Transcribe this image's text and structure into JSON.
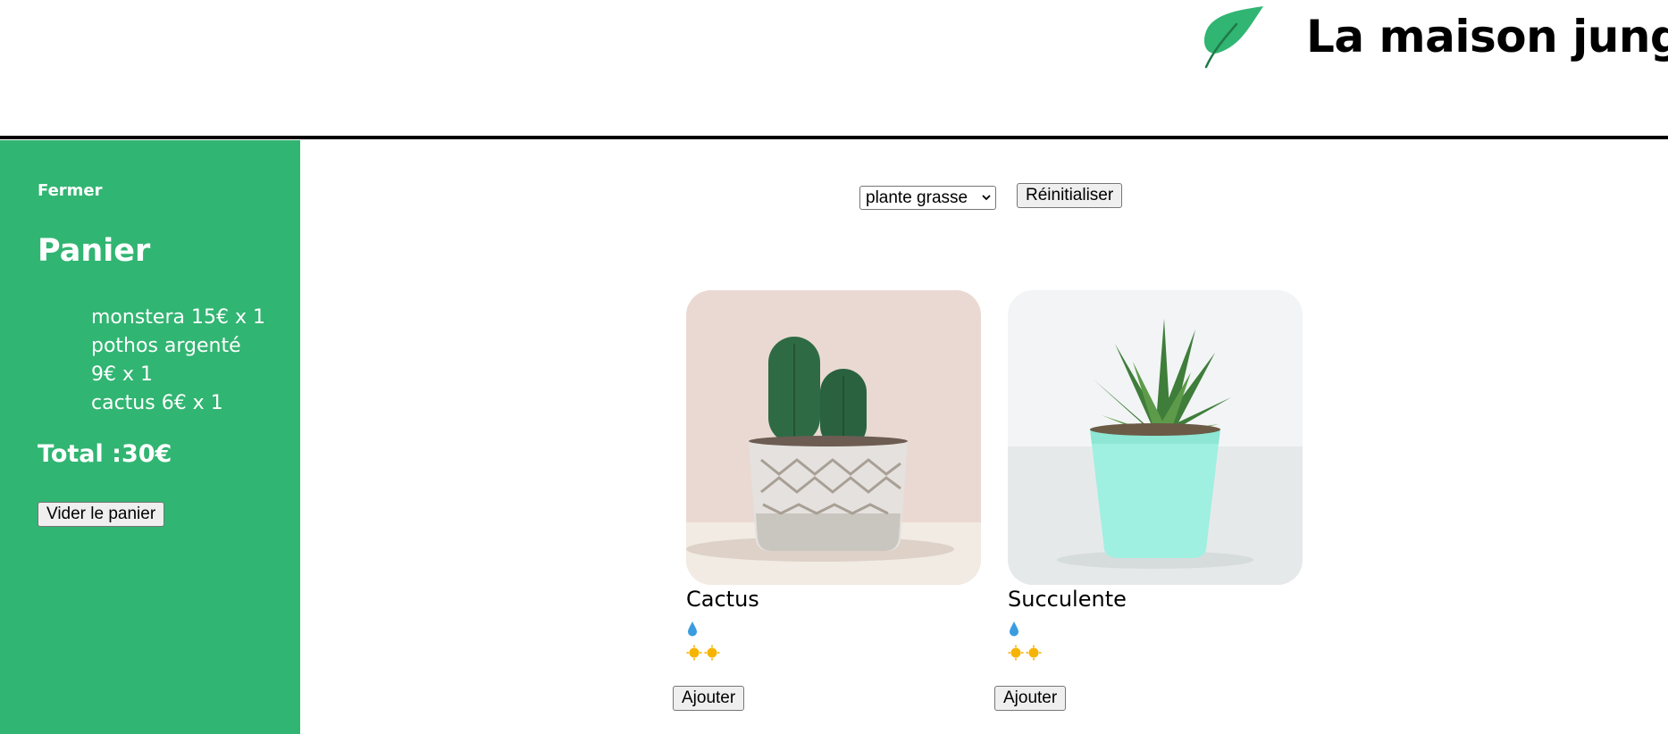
{
  "header": {
    "title": "La maison jungle",
    "logo_icon": "leaf-icon",
    "logo_color": "#31b572"
  },
  "cart": {
    "close_label": "Fermer",
    "title": "Panier",
    "items": [
      "monstera 15€ x 1",
      "pothos argenté 9€ x 1",
      "cactus 6€ x 1"
    ],
    "total": "Total :30€",
    "empty_label": "Vider le panier",
    "background": "#31b572"
  },
  "filters": {
    "category_value": "plante grasse",
    "reset_label": "Réinitialiser"
  },
  "products": [
    {
      "name": "Cactus",
      "water_level": 1,
      "light_level": 2,
      "add_label": "Ajouter"
    },
    {
      "name": "Succulente",
      "water_level": 1,
      "light_level": 2,
      "add_label": "Ajouter"
    }
  ]
}
